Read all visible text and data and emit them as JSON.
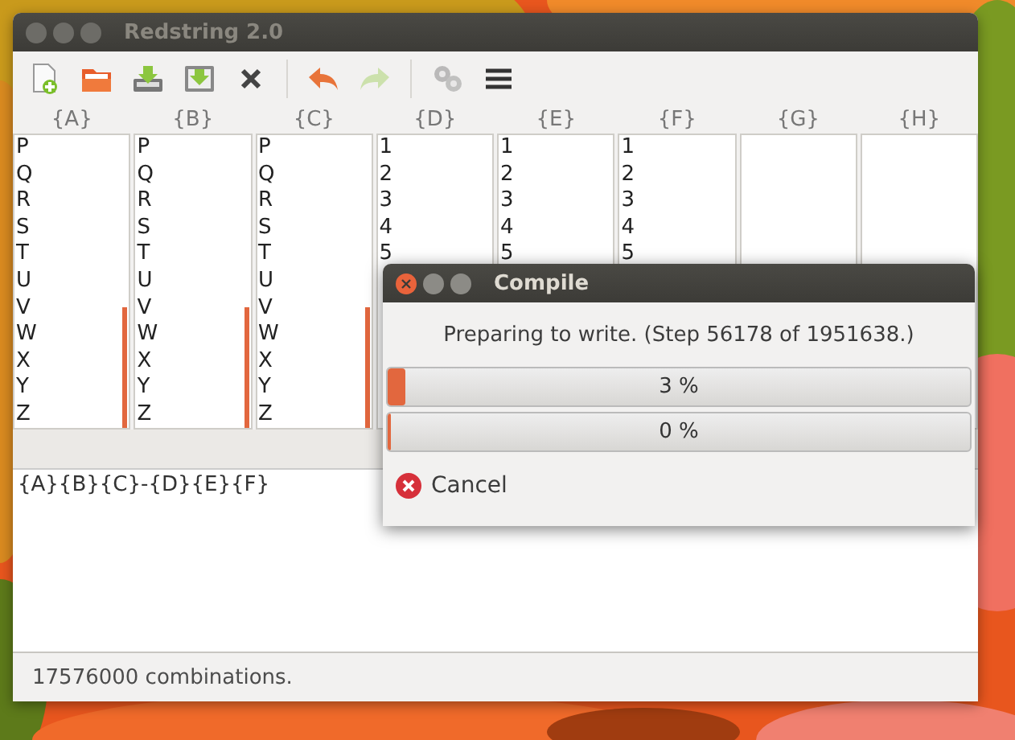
{
  "window": {
    "title": "Redstring 2.0"
  },
  "toolbar": [
    {
      "kind": "new",
      "disabled": false
    },
    {
      "kind": "open",
      "disabled": false
    },
    {
      "kind": "save",
      "disabled": false
    },
    {
      "kind": "save_as",
      "disabled": false
    },
    {
      "kind": "delete",
      "disabled": false
    },
    {
      "kind": "undo",
      "disabled": false
    },
    {
      "kind": "redo",
      "disabled": true
    },
    {
      "kind": "compile",
      "disabled": true
    },
    {
      "kind": "menu",
      "disabled": false
    }
  ],
  "columns": [
    {
      "header": "{A}",
      "items": [
        "P",
        "Q",
        "R",
        "S",
        "T",
        "U",
        "V",
        "W",
        "X",
        "Y",
        "Z"
      ]
    },
    {
      "header": "{B}",
      "items": [
        "P",
        "Q",
        "R",
        "S",
        "T",
        "U",
        "V",
        "W",
        "X",
        "Y",
        "Z"
      ]
    },
    {
      "header": "{C}",
      "items": [
        "P",
        "Q",
        "R",
        "S",
        "T",
        "U",
        "V",
        "W",
        "X",
        "Y",
        "Z"
      ]
    },
    {
      "header": "{D}",
      "items": [
        "1",
        "2",
        "3",
        "4",
        "5"
      ]
    },
    {
      "header": "{E}",
      "items": [
        "1",
        "2",
        "3",
        "4",
        "5"
      ]
    },
    {
      "header": "{F}",
      "items": [
        "1",
        "2",
        "3",
        "4",
        "5"
      ]
    },
    {
      "header": "{G}"
    },
    {
      "header": "{H}"
    }
  ],
  "pattern": "{A}{B}{C}-{D}{E}{F}",
  "status_bar": "17576000 combinations.",
  "dialog": {
    "title": "Compile",
    "message": "Preparing to write. (Step 56178 of 1951638.)",
    "progress": [
      {
        "level": 0.03,
        "label": "3 %"
      },
      {
        "level": 0,
        "label": "0 %"
      }
    ],
    "cancel": "Cancel"
  }
}
